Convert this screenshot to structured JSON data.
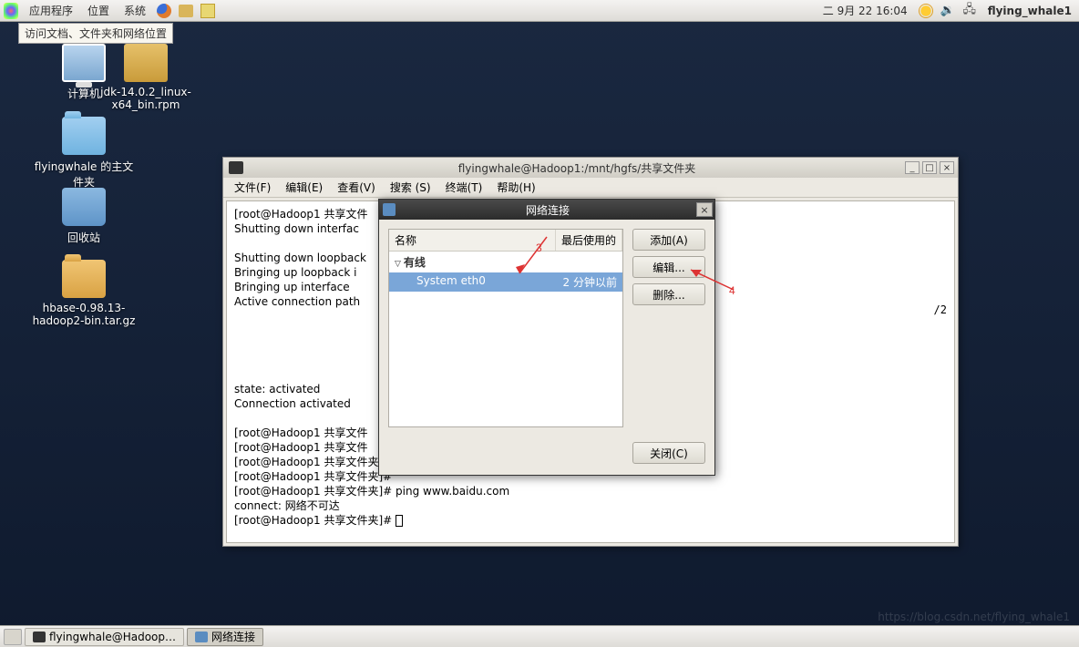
{
  "panel": {
    "applications": "应用程序",
    "places": "位置",
    "system": "系统",
    "date": "二 9月 22 16:04",
    "username": "flying_whale1",
    "tooltip": "访问文档、文件夹和网络位置"
  },
  "desktop": {
    "computer": "计算机",
    "jdk": "jdk-14.0.2_linux-x64_bin.rpm",
    "home": "flyingwhale 的主文件夹",
    "trash": "回收站",
    "hbase": "hbase-0.98.13-hadoop2-bin.tar.gz"
  },
  "terminal": {
    "title": "flyingwhale@Hadoop1:/mnt/hgfs/共享文件夹",
    "menu": {
      "file": "文件(F)",
      "edit": "编辑(E)",
      "view": "查看(V)",
      "search": "搜索 (S)",
      "terminal": "终端(T)",
      "help": "帮助(H)"
    },
    "lines": [
      "[root@Hadoop1 共享文件",
      "Shutting down interfac",
      "",
      "Shutting down loopback",
      "Bringing up loopback i",
      "Bringing up interface ",
      "Active connection path",
      "",
      "",
      "",
      "",
      "",
      "state: activated",
      "Connection activated",
      "",
      "[root@Hadoop1 共享文件",
      "[root@Hadoop1 共享文件",
      "[root@Hadoop1 共享文件夹]#",
      "[root@Hadoop1 共享文件夹]#",
      "[root@Hadoop1 共享文件夹]# ping www.baidu.com",
      "connect: 网络不可达",
      "[root@Hadoop1 共享文件夹]# "
    ],
    "frag_right": "/2"
  },
  "netdlg": {
    "title": "网络连接",
    "col_name": "名称",
    "col_last": "最后使用的",
    "group_wired": "有线",
    "row_name": "System eth0",
    "row_time": "2 分钟以前",
    "btn_add": "添加(A)",
    "btn_edit": "编辑...",
    "btn_del": "删除...",
    "btn_close": "关闭(C)"
  },
  "ann": {
    "l3": "3",
    "l4": "4"
  },
  "taskbar": {
    "t1": "flyingwhale@Hadoop…",
    "t2": "网络连接"
  },
  "watermark": "https://blog.csdn.net/flying_whale1"
}
